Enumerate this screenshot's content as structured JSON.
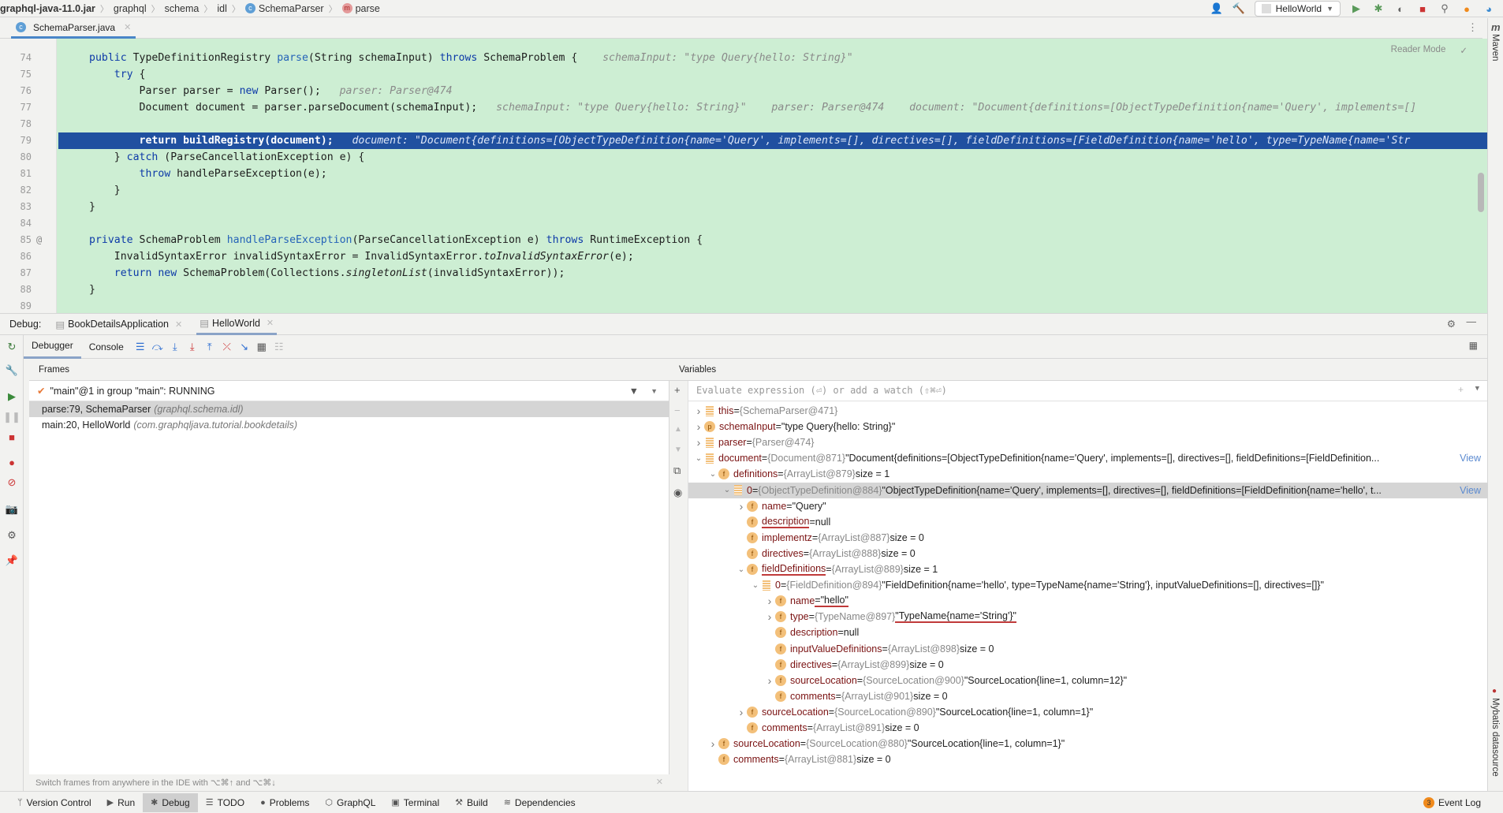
{
  "breadcrumb": [
    "graphql-java-11.0.jar",
    "graphql",
    "schema",
    "idl",
    "SchemaParser",
    "parse"
  ],
  "toolbar": {
    "run_config": "HelloWorld"
  },
  "editor_tab": {
    "label": "SchemaParser.java"
  },
  "editor": {
    "reader_mode": "Reader Mode",
    "lines": [
      {
        "n": "74",
        "code": [
          {
            "t": "public ",
            "c": "kw"
          },
          {
            "t": "TypeDefinitionRegistry "
          },
          {
            "t": "parse",
            "c": "fn"
          },
          {
            "t": "(String schemaInput) "
          },
          {
            "t": "throws ",
            "c": "kw"
          },
          {
            "t": "SchemaProblem { "
          }
        ],
        "hint": "schemaInput: \"type Query{hello: String}\""
      },
      {
        "n": "75",
        "code": [
          {
            "t": "    try ",
            "c": "kw"
          },
          {
            "t": "{"
          }
        ],
        "hint": ""
      },
      {
        "n": "76",
        "code": [
          {
            "t": "        Parser parser = "
          },
          {
            "t": "new ",
            "c": "kw"
          },
          {
            "t": "Parser();"
          }
        ],
        "hint": "parser: Parser@474"
      },
      {
        "n": "77",
        "code": [
          {
            "t": "        Document document = parser.parseDocument(schemaInput);"
          }
        ],
        "hint": "schemaInput: \"type Query{hello: String}\"    parser: Parser@474    document: \"Document{definitions=[ObjectTypeDefinition{name='Query', implements=[]"
      },
      {
        "n": "78",
        "code": [],
        "hint": ""
      },
      {
        "n": "79",
        "code": [
          {
            "t": "        return buildRegistry(document);"
          }
        ],
        "hint": "document: \"Document{definitions=[ObjectTypeDefinition{name='Query', implements=[], directives=[], fieldDefinitions=[FieldDefinition{name='hello', type=TypeName{name='Str",
        "exec": true
      },
      {
        "n": "80",
        "code": [
          {
            "t": "    } "
          },
          {
            "t": "catch ",
            "c": "kw"
          },
          {
            "t": "(ParseCancellationException e) {"
          }
        ],
        "hint": ""
      },
      {
        "n": "81",
        "code": [
          {
            "t": "        throw ",
            "c": "kw"
          },
          {
            "t": "handleParseException(e);"
          }
        ],
        "hint": ""
      },
      {
        "n": "82",
        "code": [
          {
            "t": "    }"
          }
        ],
        "hint": ""
      },
      {
        "n": "83",
        "code": [
          {
            "t": "}"
          }
        ],
        "hint": ""
      },
      {
        "n": "84",
        "code": [],
        "hint": ""
      },
      {
        "n": "85",
        "code": [
          {
            "t": "private ",
            "c": "kw"
          },
          {
            "t": "SchemaProblem "
          },
          {
            "t": "handleParseException",
            "c": "fn"
          },
          {
            "t": "(ParseCancellationException e) "
          },
          {
            "t": "throws ",
            "c": "kw"
          },
          {
            "t": "RuntimeException {"
          }
        ],
        "hint": "",
        "marker": "@"
      },
      {
        "n": "86",
        "code": [
          {
            "t": "    InvalidSyntaxError invalidSyntaxError = InvalidSyntaxError."
          },
          {
            "t": "toInvalidSyntaxError",
            "c": "it"
          },
          {
            "t": "(e);"
          }
        ],
        "hint": ""
      },
      {
        "n": "87",
        "code": [
          {
            "t": "    return new ",
            "c": "kw"
          },
          {
            "t": "SchemaProblem(Collections."
          },
          {
            "t": "singletonList",
            "c": "it"
          },
          {
            "t": "(invalidSyntaxError));"
          }
        ],
        "hint": ""
      },
      {
        "n": "88",
        "code": [
          {
            "t": "}"
          }
        ],
        "hint": ""
      },
      {
        "n": "89",
        "code": [],
        "hint": ""
      }
    ]
  },
  "debug": {
    "label": "Debug:",
    "tabs": [
      "BookDetailsApplication",
      "HelloWorld"
    ],
    "toolbar_tabs": [
      "Debugger",
      "Console"
    ],
    "frames_title": "Frames",
    "thread": "\"main\"@1 in group \"main\": RUNNING",
    "frames": [
      {
        "loc": "parse:79, SchemaParser",
        "pkg": "(graphql.schema.idl)",
        "selected": true
      },
      {
        "loc": "main:20, HelloWorld",
        "pkg": "(com.graphqljava.tutorial.bookdetails)",
        "selected": false
      }
    ],
    "tip": "Switch frames from anywhere in the IDE with ⌥⌘↑ and ⌥⌘↓",
    "variables_title": "Variables",
    "eval_placeholder": "Evaluate expression (⏎) or add a watch (⇧⌘⏎)",
    "variables": [
      {
        "d": 0,
        "arrow": ">",
        "icon": "list",
        "name": "this",
        "type": "{SchemaParser@471}",
        "val": ""
      },
      {
        "d": 0,
        "arrow": ">",
        "icon": "p",
        "name": "schemaInput",
        "type": "",
        "val": "\"type Query{hello: String}\""
      },
      {
        "d": 0,
        "arrow": ">",
        "icon": "list",
        "name": "parser",
        "type": "{Parser@474}",
        "val": ""
      },
      {
        "d": 0,
        "arrow": "v",
        "icon": "list",
        "name": "document",
        "type": "{Document@871}",
        "val": "\"Document{definitions=[ObjectTypeDefinition{name='Query', implements=[], directives=[], fieldDefinitions=[FieldDefinition...",
        "view": "View"
      },
      {
        "d": 1,
        "arrow": "v",
        "icon": "f",
        "name": "definitions",
        "type": "{ArrayList@879}",
        "val": " size = 1"
      },
      {
        "d": 2,
        "arrow": "v",
        "icon": "list",
        "name": "0",
        "type": "{ObjectTypeDefinition@884}",
        "val": "\"ObjectTypeDefinition{name='Query', implements=[], directives=[], fieldDefinitions=[FieldDefinition{name='hello', t...",
        "view": "View",
        "selected": true
      },
      {
        "d": 3,
        "arrow": ">",
        "icon": "f",
        "name": "name",
        "type": "",
        "val": "\"Query\""
      },
      {
        "d": 3,
        "arrow": "",
        "icon": "f",
        "name": "description",
        "type": "",
        "val": "null"
      },
      {
        "d": 3,
        "arrow": "",
        "icon": "f",
        "name": "implementz",
        "type": "{ArrayList@887}",
        "val": " size = 0"
      },
      {
        "d": 3,
        "arrow": "",
        "icon": "f",
        "name": "directives",
        "type": "{ArrayList@888}",
        "val": " size = 0"
      },
      {
        "d": 3,
        "arrow": "v",
        "icon": "f",
        "name": "fieldDefinitions",
        "type": "{ArrayList@889}",
        "val": " size = 1"
      },
      {
        "d": 4,
        "arrow": "v",
        "icon": "list",
        "name": "0",
        "type": "{FieldDefinition@894}",
        "val": "\"FieldDefinition{name='hello', type=TypeName{name='String'}, inputValueDefinitions=[], directives=[]}\""
      },
      {
        "d": 5,
        "arrow": ">",
        "icon": "f",
        "name": "name",
        "type": "",
        "val": "\"hello\""
      },
      {
        "d": 5,
        "arrow": ">",
        "icon": "f",
        "name": "type",
        "type": "{TypeName@897}",
        "val": "\"TypeName{name='String'}\""
      },
      {
        "d": 5,
        "arrow": "",
        "icon": "f",
        "name": "description",
        "type": "",
        "val": "null"
      },
      {
        "d": 5,
        "arrow": "",
        "icon": "f",
        "name": "inputValueDefinitions",
        "type": "{ArrayList@898}",
        "val": " size = 0"
      },
      {
        "d": 5,
        "arrow": "",
        "icon": "f",
        "name": "directives",
        "type": "{ArrayList@899}",
        "val": " size = 0"
      },
      {
        "d": 5,
        "arrow": ">",
        "icon": "f",
        "name": "sourceLocation",
        "type": "{SourceLocation@900}",
        "val": "\"SourceLocation{line=1, column=12}\""
      },
      {
        "d": 5,
        "arrow": "",
        "icon": "f",
        "name": "comments",
        "type": "{ArrayList@901}",
        "val": " size = 0"
      },
      {
        "d": 3,
        "arrow": ">",
        "icon": "f",
        "name": "sourceLocation",
        "type": "{SourceLocation@890}",
        "val": "\"SourceLocation{line=1, column=1}\""
      },
      {
        "d": 3,
        "arrow": "",
        "icon": "f",
        "name": "comments",
        "type": "{ArrayList@891}",
        "val": " size = 0"
      },
      {
        "d": 1,
        "arrow": ">",
        "icon": "f",
        "name": "sourceLocation",
        "type": "{SourceLocation@880}",
        "val": "\"SourceLocation{line=1, column=1}\""
      },
      {
        "d": 1,
        "arrow": "",
        "icon": "f",
        "name": "comments",
        "type": "{ArrayList@881}",
        "val": " size = 0"
      }
    ]
  },
  "right_tools": [
    "Maven",
    "Mybatis datasource"
  ],
  "status_bar": {
    "items": [
      {
        "icon": "version-control-icon",
        "glyph": "ᛘ",
        "label": "Version Control"
      },
      {
        "icon": "run-icon",
        "glyph": "▶",
        "label": "Run"
      },
      {
        "icon": "debug-icon",
        "glyph": "✱",
        "label": "Debug",
        "active": true
      },
      {
        "icon": "todo-icon",
        "glyph": "☰",
        "label": "TODO"
      },
      {
        "icon": "problems-icon",
        "glyph": "●",
        "label": "Problems"
      },
      {
        "icon": "graphql-icon",
        "glyph": "⬡",
        "label": "GraphQL"
      },
      {
        "icon": "terminal-icon",
        "glyph": "▣",
        "label": "Terminal"
      },
      {
        "icon": "build-icon",
        "glyph": "⚒",
        "label": "Build"
      },
      {
        "icon": "dependencies-icon",
        "glyph": "≋",
        "label": "Dependencies"
      }
    ],
    "event_log": "Event Log",
    "event_count": "3"
  }
}
